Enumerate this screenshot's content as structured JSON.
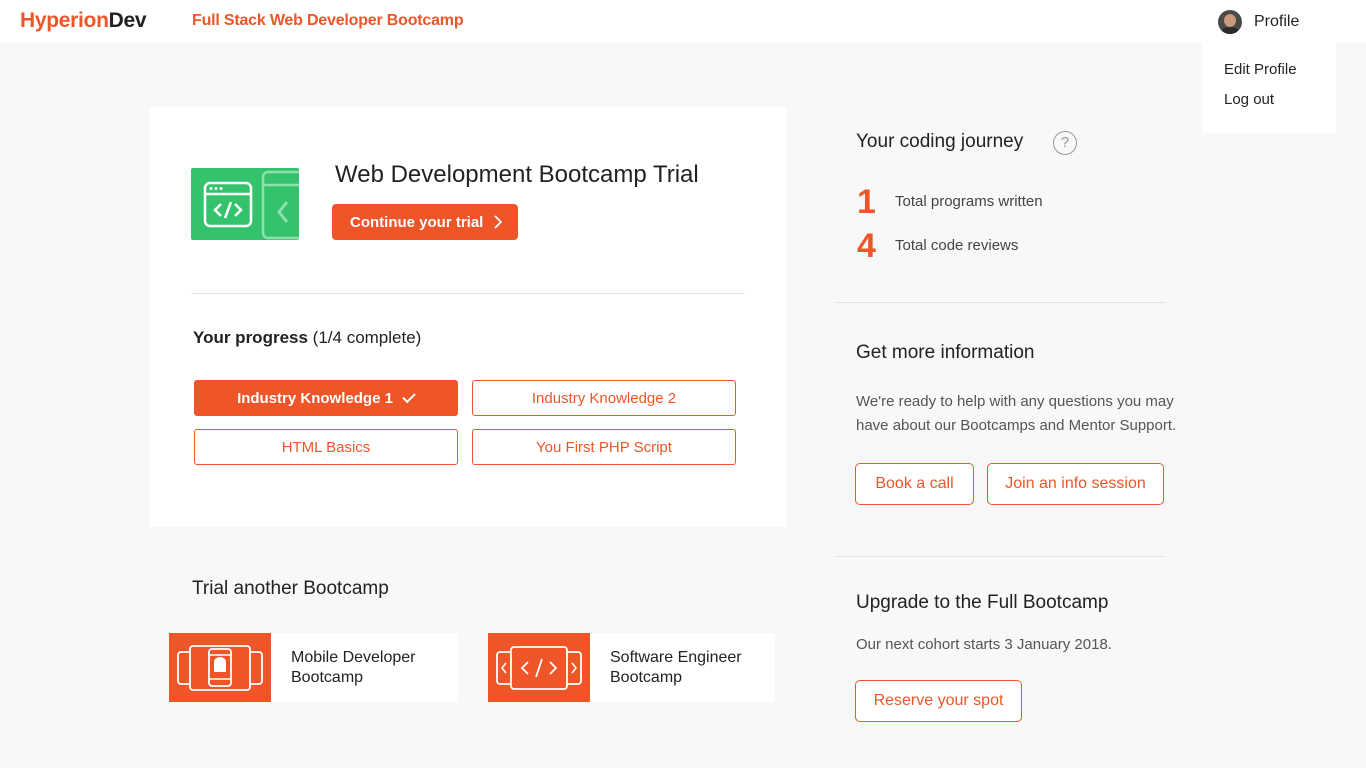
{
  "header": {
    "logo_part1": "Hyperion",
    "logo_part2": "Dev",
    "course_link": "Full Stack Web Developer Bootcamp",
    "profile_label": "Profile",
    "dropdown": [
      "Edit Profile",
      "Log out"
    ]
  },
  "course_card": {
    "title": "Web Development Bootcamp Trial",
    "continue_label": "Continue your trial",
    "progress_label": "Your progress",
    "progress_count": "(1/4 complete)",
    "modules": [
      {
        "label": "Industry Knowledge 1",
        "completed": true
      },
      {
        "label": "Industry Knowledge 2",
        "completed": false
      },
      {
        "label": "HTML Basics",
        "completed": false
      },
      {
        "label": "You First PHP Script",
        "completed": false
      }
    ]
  },
  "trial_other": {
    "title": "Trial another Bootcamp",
    "bootcamps": [
      {
        "line1": "Mobile Developer",
        "line2": "Bootcamp",
        "icon": "android-phone-icon"
      },
      {
        "line1": "Software Engineer",
        "line2": "Bootcamp",
        "icon": "code-window-icon"
      }
    ]
  },
  "journey": {
    "title": "Your coding journey",
    "help_icon": "?",
    "stats": [
      {
        "value": "1",
        "label": "Total programs written"
      },
      {
        "value": "4",
        "label": "Total code reviews"
      }
    ]
  },
  "info": {
    "title": "Get more information",
    "text_line1": "We're ready to help with any questions you may",
    "text_line2": "have about our Bootcamps and Mentor Support.",
    "book_call": "Book a call",
    "join_session": "Join an info session"
  },
  "upgrade": {
    "title": "Upgrade to the Full Bootcamp",
    "text": "Our next cohort starts 3 January 2018.",
    "reserve": "Reserve your spot"
  },
  "colors": {
    "accent": "#ee5528",
    "course_icon": "#35c26c"
  }
}
